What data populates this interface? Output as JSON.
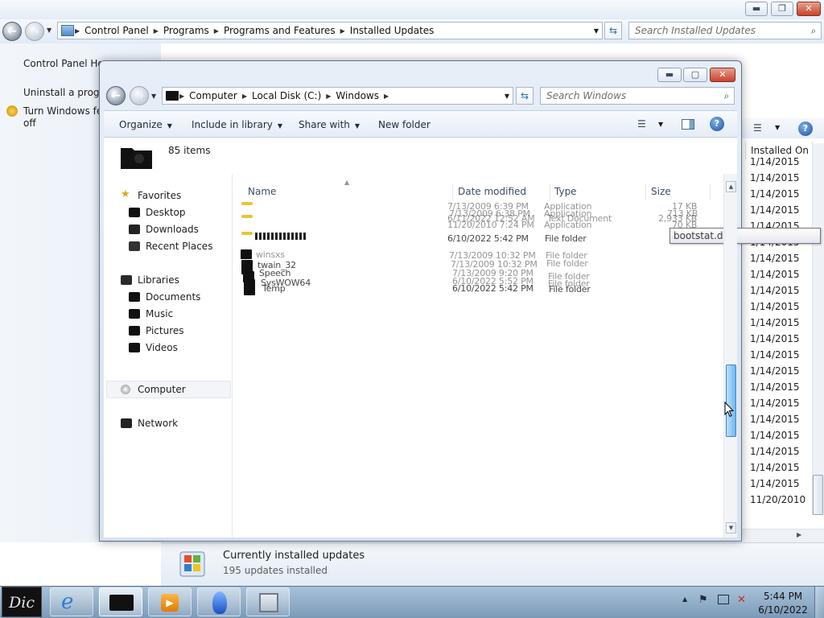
{
  "background_window": {
    "nav": {
      "breadcrumb": [
        "Control Panel",
        "Programs",
        "Programs and Features",
        "Installed Updates"
      ],
      "search_placeholder": "Search Installed Updates"
    },
    "sidebar": {
      "items": [
        {
          "label": "Control Panel Home"
        },
        {
          "label": "Uninstall a program"
        },
        {
          "label": "Turn Windows features on or"
        },
        {
          "label": "off"
        }
      ]
    },
    "list": {
      "column": "Installed On",
      "dates": [
        "1/14/2015",
        "1/14/2015",
        "1/14/2015",
        "1/14/2015",
        "1/14/2015",
        "1/14/2015",
        "1/14/2015",
        "1/14/2015",
        "1/14/2015",
        "1/14/2015",
        "1/14/2015",
        "1/14/2015",
        "1/14/2015",
        "1/14/2015",
        "1/14/2015",
        "1/14/2015",
        "1/14/2015",
        "1/14/2015",
        "1/14/2015",
        "1/14/2015",
        "1/14/2015",
        "11/20/2010"
      ]
    },
    "details": {
      "title": "Currently installed updates",
      "count": "195 updates installed"
    }
  },
  "explorer": {
    "nav": {
      "breadcrumb": [
        "Computer",
        "Local Disk (C:)",
        "Windows"
      ],
      "search_placeholder": "Search Windows"
    },
    "toolbar": {
      "organize": "Organize",
      "include": "Include in library",
      "share": "Share with",
      "new_folder": "New folder"
    },
    "item_count": "85 items",
    "navpane": {
      "favorites": "Favorites",
      "desktop": "Desktop",
      "downloads": "Downloads",
      "recent": "Recent Places",
      "libraries": "Libraries",
      "documents": "Documents",
      "music": "Music",
      "pictures": "Pictures",
      "videos": "Videos",
      "computer": "Computer",
      "network": "Network"
    },
    "columns": {
      "name": "Name",
      "date": "Date modified",
      "type": "Type",
      "size": "Size"
    },
    "ghost_rows": {
      "g1": {
        "date": "7/13/2009 6:39 PM",
        "type": "Application",
        "size": "17 KB"
      },
      "g2": {
        "date": "7/13/2009 6:38 PM",
        "type": "Application",
        "size": "713 KB"
      },
      "g3": {
        "date": "6/11/2022 12:52 AM",
        "type": "Text Document",
        "size": "2,933 KB"
      },
      "g4": {
        "date": "11/20/2010 7:24 PM",
        "type": "Application",
        "size": "70 KB"
      },
      "g5": {
        "date": "6/10/2022 5:42 PM",
        "type": "File folder"
      },
      "g6": {
        "name": "winsxs",
        "date": "7/13/2009 10:32 PM",
        "type": "File folder"
      },
      "g7": {
        "name": "twain_32",
        "date": "7/13/2009 10:32 PM",
        "type": "File folder"
      },
      "g8": {
        "name": "Speech",
        "date": "7/13/2009 9:20 PM",
        "type": "File folder"
      },
      "g9": {
        "name": "SysWOW64",
        "date": "6/10/2022 5:52 PM",
        "type": "File folder"
      },
      "g10": {
        "name": "Temp",
        "date": "6/10/2022 5:42 PM",
        "type": "File folder"
      }
    },
    "tooltip": "bootstat.dat"
  },
  "taskbar": {
    "start_label": "Dic",
    "clock_time": "5:44 PM",
    "clock_date": "6/10/2022"
  }
}
